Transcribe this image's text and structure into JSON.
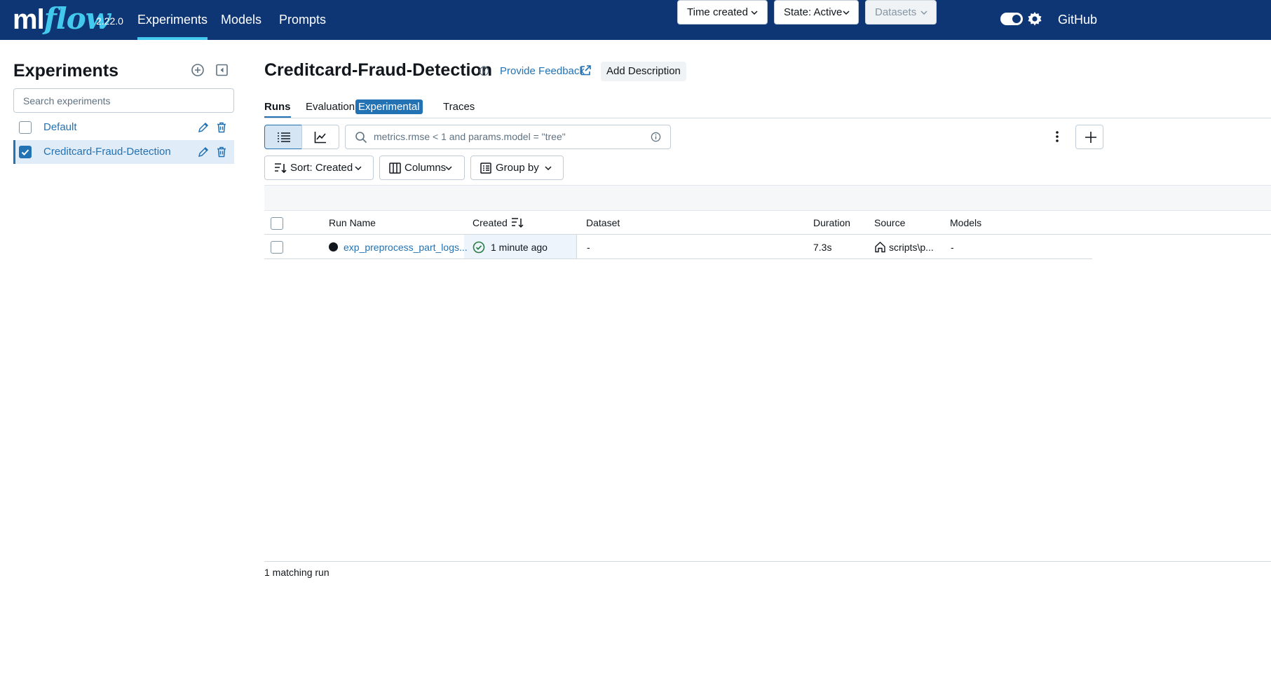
{
  "header": {
    "logo_ml": "ml",
    "logo_flow": "flow",
    "version": "2.22.0",
    "nav": [
      {
        "label": "Experiments",
        "active": true
      },
      {
        "label": "Models",
        "active": false
      },
      {
        "label": "Prompts",
        "active": false
      }
    ],
    "github_label": "GitHub"
  },
  "sidebar": {
    "title": "Experiments",
    "search_placeholder": "Search experiments",
    "experiments": [
      {
        "name": "Default",
        "checked": false
      },
      {
        "name": "Creditcard-Fraud-Detection",
        "checked": true
      }
    ]
  },
  "experiment": {
    "title": "Creditcard-Fraud-Detection",
    "feedback_label": "Provide Feedback",
    "add_description_label": "Add Description"
  },
  "tabs": {
    "runs": "Runs",
    "evaluation": "Evaluation",
    "experimental_badge": "Experimental",
    "traces": "Traces"
  },
  "toolbar": {
    "filter_placeholder": "metrics.rmse < 1 and params.model = \"tree\"",
    "time_created": "Time created",
    "state": "State: Active",
    "datasets": "Datasets",
    "sort": "Sort: Created",
    "columns": "Columns",
    "group_by": "Group by"
  },
  "table": {
    "columns": [
      "Run Name",
      "Created",
      "Dataset",
      "Duration",
      "Source",
      "Models"
    ],
    "rows": [
      {
        "run_name": "exp_preprocess_part_logs...",
        "created": "1 minute ago",
        "dataset": "-",
        "duration": "7.3s",
        "source": "scripts\\p...",
        "models": "-"
      }
    ],
    "footer": "1 matching run"
  },
  "colors": {
    "nav_bg": "#0e3674",
    "accent": "#2272b4",
    "logo_flow": "#43c9ed",
    "success": "#277c43"
  }
}
